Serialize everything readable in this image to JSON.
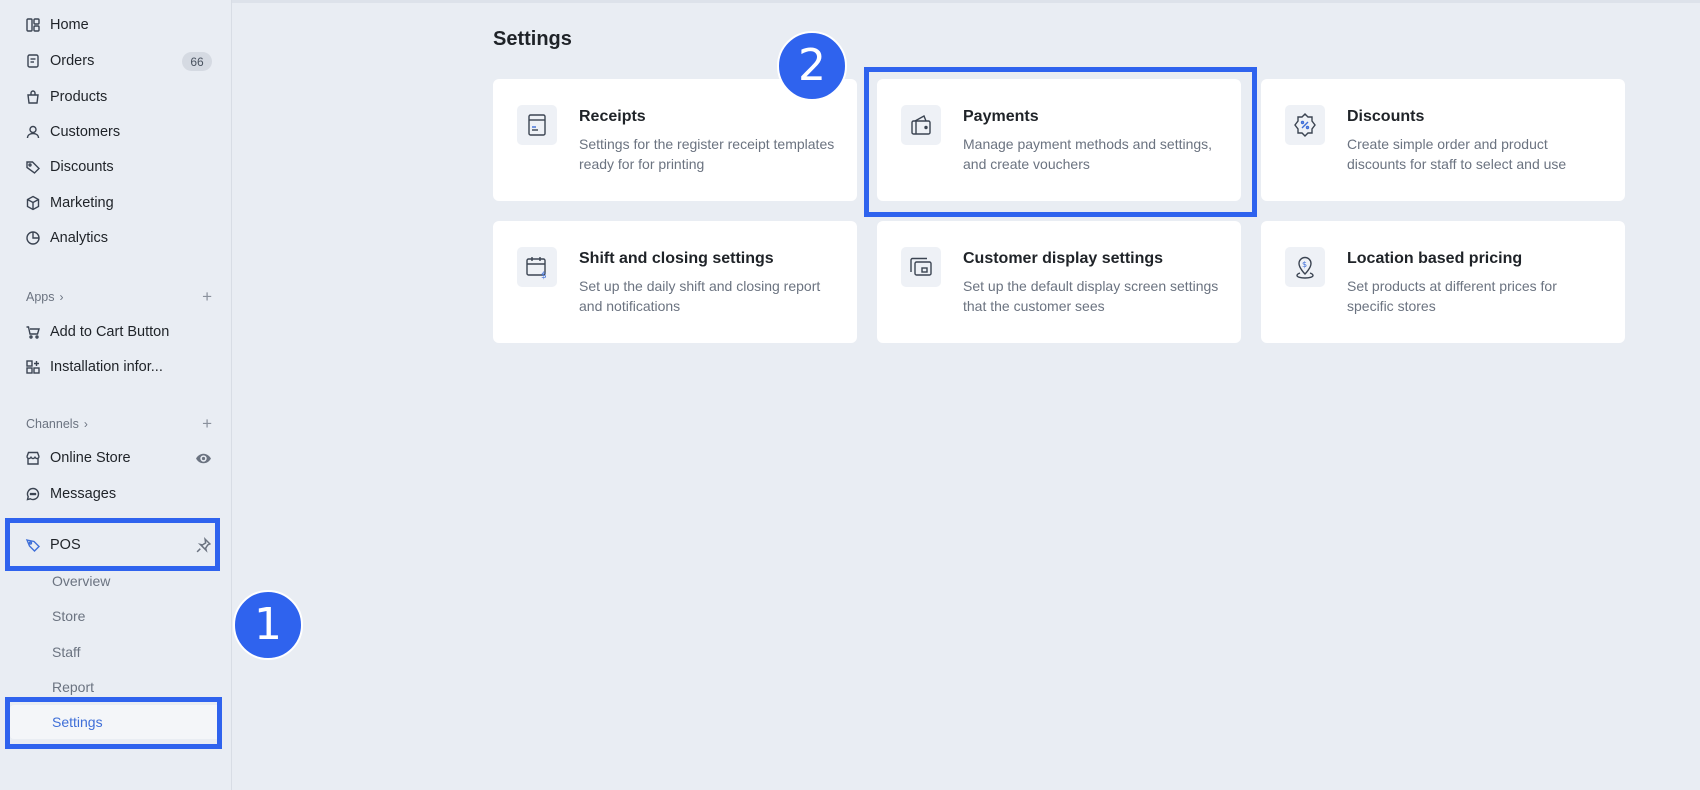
{
  "sidebar": {
    "main_nav": [
      {
        "label": "Home",
        "icon": "home-icon"
      },
      {
        "label": "Orders",
        "icon": "orders-icon",
        "badge": "66"
      },
      {
        "label": "Products",
        "icon": "products-icon"
      },
      {
        "label": "Customers",
        "icon": "customers-icon"
      },
      {
        "label": "Discounts",
        "icon": "tag-icon"
      },
      {
        "label": "Marketing",
        "icon": "marketing-icon"
      },
      {
        "label": "Analytics",
        "icon": "analytics-icon"
      }
    ],
    "apps": {
      "header": "Apps",
      "items": [
        {
          "label": "Add to Cart Button",
          "icon": "cart-icon"
        },
        {
          "label": "Installation infor...",
          "icon": "installation-icon"
        }
      ]
    },
    "channels": {
      "header": "Channels",
      "items": [
        {
          "label": "Online Store",
          "icon": "store-icon"
        },
        {
          "label": "Messages",
          "icon": "messages-icon"
        },
        {
          "label": "POS",
          "icon": "pos-icon"
        }
      ],
      "pos_sub_items": [
        {
          "label": "Overview"
        },
        {
          "label": "Store"
        },
        {
          "label": "Staff"
        },
        {
          "label": "Report"
        },
        {
          "label": "Settings",
          "active": true
        }
      ]
    }
  },
  "main": {
    "title": "Settings",
    "cards": [
      {
        "title": "Receipts",
        "description": "Settings for the register receipt templates ready for for printing",
        "icon": "receipt-icon"
      },
      {
        "title": "Payments",
        "description": "Manage payment methods and settings, and create vouchers",
        "icon": "wallet-icon"
      },
      {
        "title": "Discounts",
        "description": "Create simple order and product discounts for staff to select and use",
        "icon": "discount-badge-icon"
      },
      {
        "title": "Shift and closing settings",
        "description": "Set up the daily shift and closing report and notifications",
        "icon": "calendar-dollar-icon"
      },
      {
        "title": "Customer display settings",
        "description": "Set up the default display screen settings that the customer sees",
        "icon": "display-icon"
      },
      {
        "title": "Location based pricing",
        "description": "Set products at different prices for specific stores",
        "icon": "location-dollar-icon"
      }
    ]
  },
  "annotations": {
    "marker_1": "1",
    "marker_2": "2",
    "highlight_color": "#2f63ee"
  }
}
